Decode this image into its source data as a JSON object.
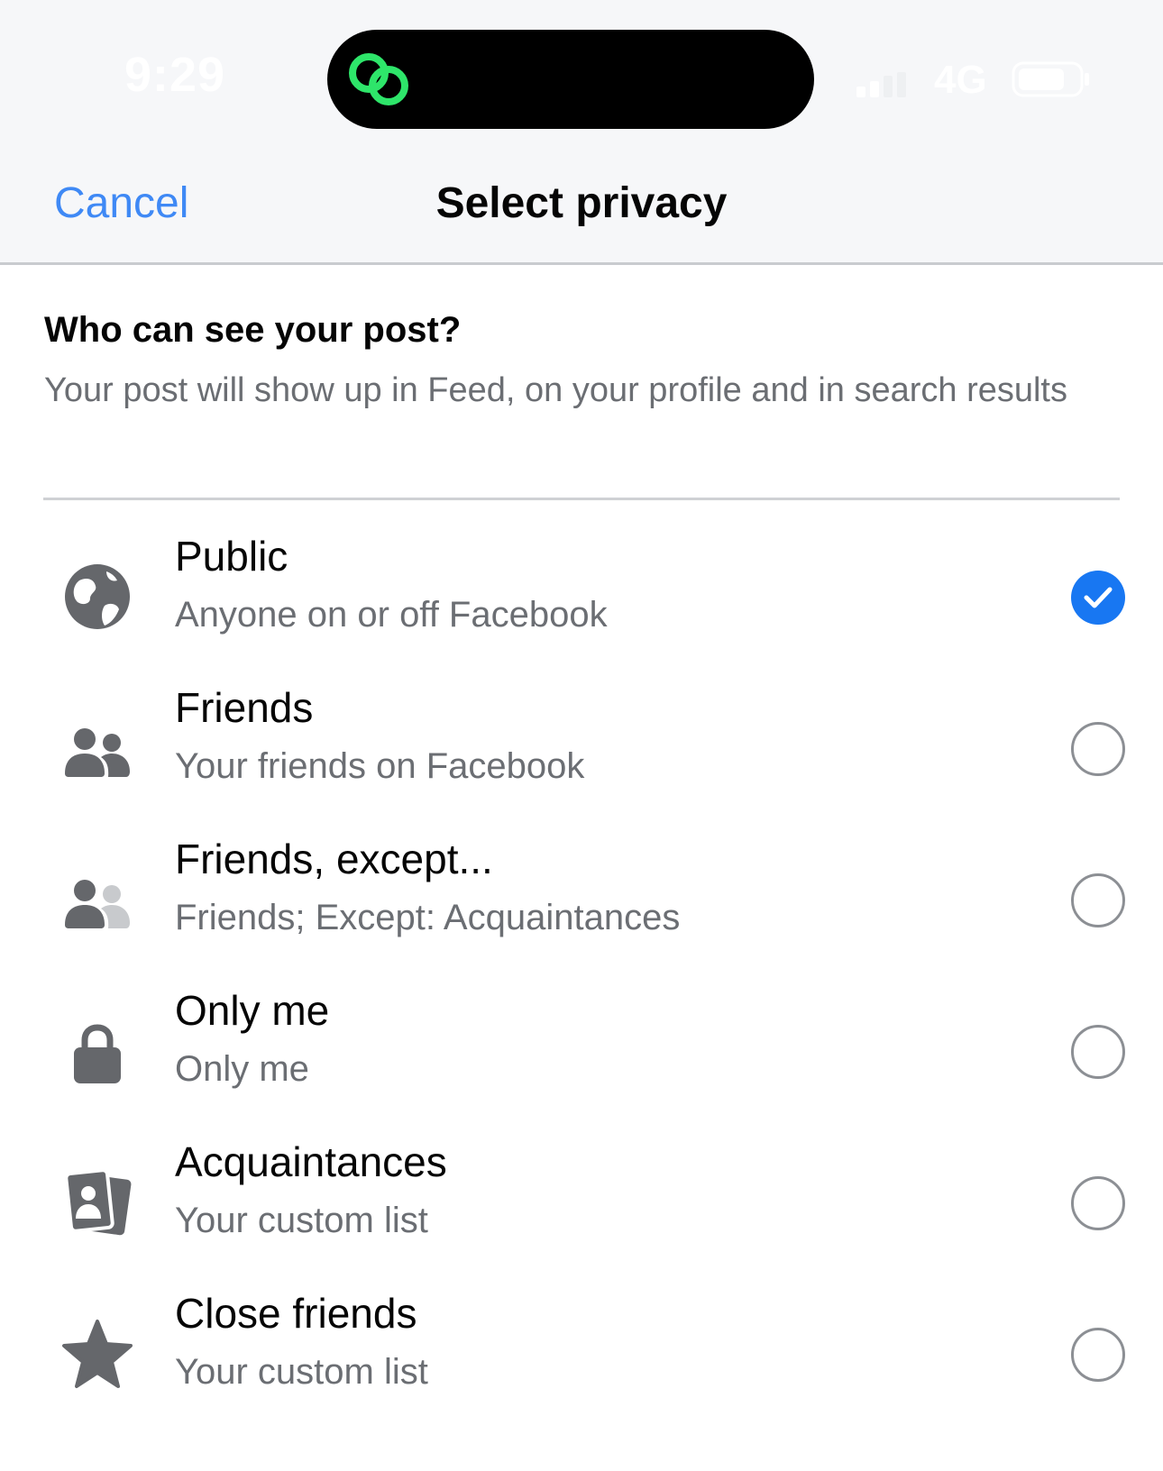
{
  "status_bar": {
    "time": "9:29",
    "network": "4G"
  },
  "header": {
    "cancel_label": "Cancel",
    "title": "Select privacy"
  },
  "intro": {
    "question": "Who can see your post?",
    "description": "Your post will show up in Feed, on your profile and in search results"
  },
  "options": [
    {
      "label": "Public",
      "sublabel": "Anyone on or off Facebook",
      "icon": "globe-icon",
      "selected": true
    },
    {
      "label": "Friends",
      "sublabel": "Your friends on Facebook",
      "icon": "friends-icon",
      "selected": false
    },
    {
      "label": "Friends, except...",
      "sublabel": "Friends; Except: Acquaintances",
      "icon": "friends-except-icon",
      "selected": false
    },
    {
      "label": "Only me",
      "sublabel": "Only me",
      "icon": "lock-icon",
      "selected": false
    },
    {
      "label": "Acquaintances",
      "sublabel": "Your custom list",
      "icon": "contact-cards-icon",
      "selected": false
    },
    {
      "label": "Close friends",
      "sublabel": "Your custom list",
      "icon": "star-icon",
      "selected": false
    }
  ],
  "colors": {
    "accent": "#1877f2",
    "cancel": "#3f89f5",
    "icon": "#65676b",
    "island_link": "#2ee56a"
  }
}
